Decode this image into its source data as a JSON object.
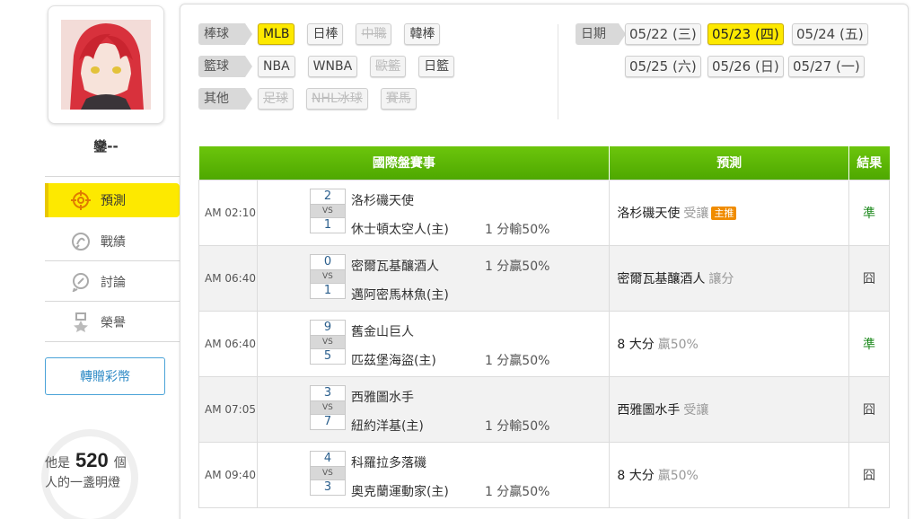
{
  "user": {
    "name": "鑾--"
  },
  "menu": [
    {
      "label": "預測",
      "icon": "target-icon",
      "active": true
    },
    {
      "label": "戰績",
      "icon": "chart-icon",
      "active": false
    },
    {
      "label": "討論",
      "icon": "discussion-icon",
      "active": false
    },
    {
      "label": "榮譽",
      "icon": "medal-icon",
      "active": false
    }
  ],
  "gift_button": "轉贈彩幣",
  "lamp": {
    "prefix": "他是",
    "count": "520",
    "suffix1": "個",
    "suffix2": "人的一盞明燈"
  },
  "categories": [
    {
      "label": "棒球",
      "chips": [
        {
          "text": "MLB",
          "state": "active"
        },
        {
          "text": "日棒",
          "state": "normal"
        },
        {
          "text": "中職",
          "state": "disabled"
        },
        {
          "text": "韓棒",
          "state": "normal"
        }
      ]
    },
    {
      "label": "籃球",
      "chips": [
        {
          "text": "NBA",
          "state": "normal"
        },
        {
          "text": "WNBA",
          "state": "normal"
        },
        {
          "text": "歐籃",
          "state": "disabled"
        },
        {
          "text": "日籃",
          "state": "normal"
        }
      ]
    },
    {
      "label": "其他",
      "chips": [
        {
          "text": "足球",
          "state": "disabled"
        },
        {
          "text": "NHL冰球",
          "state": "disabled"
        },
        {
          "text": "賽馬",
          "state": "disabled"
        }
      ]
    }
  ],
  "dates": {
    "label": "日期",
    "items": [
      {
        "text": "05/22 (三)",
        "active": false
      },
      {
        "text": "05/23 (四)",
        "active": true
      },
      {
        "text": "05/24 (五)",
        "active": false
      },
      {
        "text": "05/25 (六)",
        "active": false
      },
      {
        "text": "05/26 (日)",
        "active": false
      },
      {
        "text": "05/27 (一)",
        "active": false
      }
    ]
  },
  "table": {
    "headers": {
      "match": "國際盤賽事",
      "prediction": "預測",
      "result": "結果"
    },
    "rows": [
      {
        "time": "AM 02:10",
        "score1": "2",
        "score2": "1",
        "vs": "VS",
        "team1": "洛杉磯天使",
        "team2": "休士頓太空人(主)",
        "line1": "",
        "line2": "1 分輸50%",
        "prediction": "洛杉磯天使",
        "pred_extra": "受讓",
        "badge": "主推",
        "result": "準",
        "result_type": "win"
      },
      {
        "time": "AM 06:40",
        "score1": "0",
        "score2": "1",
        "vs": "VS",
        "team1": "密爾瓦基釀酒人",
        "team2": "邁阿密馬林魚(主)",
        "line1": "1 分贏50%",
        "line2": "",
        "prediction": "密爾瓦基釀酒人",
        "pred_extra": "讓分",
        "badge": "",
        "result": "囧",
        "result_type": "lose"
      },
      {
        "time": "AM 06:40",
        "score1": "9",
        "score2": "5",
        "vs": "VS",
        "team1": "舊金山巨人",
        "team2": "匹茲堡海盜(主)",
        "line1": "",
        "line2": "1 分贏50%",
        "prediction": "8 大分",
        "pred_extra": "贏50%",
        "badge": "",
        "result": "準",
        "result_type": "win"
      },
      {
        "time": "AM 07:05",
        "score1": "3",
        "score2": "7",
        "vs": "VS",
        "team1": "西雅圖水手",
        "team2": "紐約洋基(主)",
        "line1": "",
        "line2": "1 分輸50%",
        "prediction": "西雅圖水手",
        "pred_extra": "受讓",
        "badge": "",
        "result": "囧",
        "result_type": "lose"
      },
      {
        "time": "AM 09:40",
        "score1": "4",
        "score2": "3",
        "vs": "VS",
        "team1": "科羅拉多落磯",
        "team2": "奧克蘭運動家(主)",
        "line1": "",
        "line2": "1 分贏50%",
        "prediction": "8 大分",
        "pred_extra": "贏50%",
        "badge": "",
        "result": "囧",
        "result_type": "lose"
      }
    ]
  }
}
